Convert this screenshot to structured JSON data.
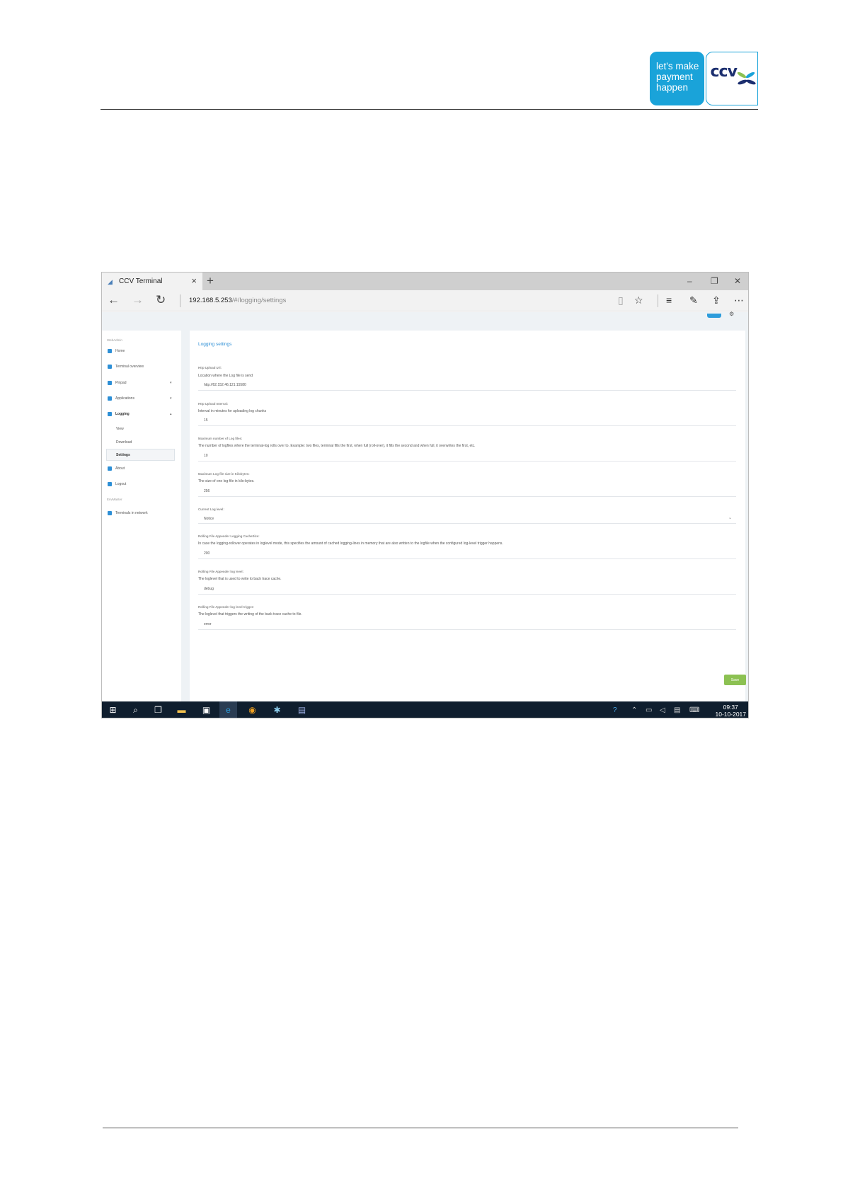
{
  "brand": {
    "slogan_lines": [
      "let's make",
      "payment",
      "happen"
    ],
    "logo_text": "ccv",
    "colors": {
      "slogan_bg": "#1aa3d9",
      "logo_text": "#1c2f6f",
      "logo_accent": "#8cc152"
    }
  },
  "browser": {
    "tab_title": "CCV Terminal",
    "tab_close_icon": "close-icon",
    "new_tab_icon": "plus-icon",
    "window_controls": [
      "minimize-icon",
      "restore-icon",
      "close-icon"
    ],
    "url_host": "192.168.5.253",
    "url_path": "/#/logging/settings"
  },
  "sidebar": {
    "section_webadmin": "WebAdmin",
    "items": [
      {
        "label": "Home",
        "icon": "home-icon"
      },
      {
        "label": "Terminal overview",
        "icon": "monitor-icon"
      },
      {
        "label": "Pinpad",
        "icon": "pinpad-icon",
        "caret": "▾"
      },
      {
        "label": "Applications",
        "icon": "apps-icon",
        "caret": "▾"
      },
      {
        "label": "Logging",
        "icon": "file-icon",
        "caret": "▴",
        "active": true
      }
    ],
    "logging_sub": [
      "View",
      "Download",
      "Settings"
    ],
    "items_after": [
      {
        "label": "About",
        "icon": "info-icon"
      },
      {
        "label": "Logout",
        "icon": "lock-icon"
      }
    ],
    "section_other": "EnvMaster",
    "network_item": {
      "label": "Terminals in network",
      "icon": "grid-icon"
    }
  },
  "content": {
    "title": "Logging settings",
    "fields": [
      {
        "label": "Http Upload Url:",
        "desc": "Location where the Log file is send",
        "value": "http://62.152.46.121:15580"
      },
      {
        "label": "Http Upload Interval:",
        "desc": "Interval in minutes for uploading log chunks",
        "value": "15"
      },
      {
        "label": "Maximum number of Log files:",
        "desc": "The number of logfiles where the terminal-log rolls over to. Example: two files, terminal fills the first, when full (roll-over), it fills the second and when full, it overwrites the first, etc.",
        "value": "10"
      },
      {
        "label": "Maximum Log file size in Kilobytes:",
        "desc": "The size of one log-file in kilo-bytes.",
        "value": "256"
      },
      {
        "label": "Current Log level:",
        "desc": "",
        "value": "Notice"
      },
      {
        "label": "Rolling File Appender Logging CacheSize:",
        "desc": "In case the logging-rollover operates in loglevel mode, this specifies the amount of cached logging-lines in memory that are also written to the logfile when the configured log-level trigger happens.",
        "value": "200"
      },
      {
        "label": "Rolling File Appender log level:",
        "desc": "The loglevel that is used to write to back trace cache.",
        "value": "debug"
      },
      {
        "label": "Rolling File Appender log level trigger:",
        "desc": "The loglevel that triggers the writing of the back trace cache to file.",
        "value": "error"
      }
    ],
    "save_label": "Save",
    "save_color": "#8cc152"
  },
  "taskbar": {
    "icons": [
      "windows-start-icon",
      "search-icon",
      "task-view-icon",
      "file-explorer-icon",
      "store-icon",
      "edge-icon",
      "chrome-icon",
      "paint-icon",
      "notepad-icon"
    ],
    "tray_icons": [
      "help-icon",
      "chevron-up-icon",
      "battery-icon",
      "volume-icon",
      "notifications-icon",
      "keyboard-icon"
    ],
    "time": "09:37",
    "date": "10-10-2017"
  }
}
